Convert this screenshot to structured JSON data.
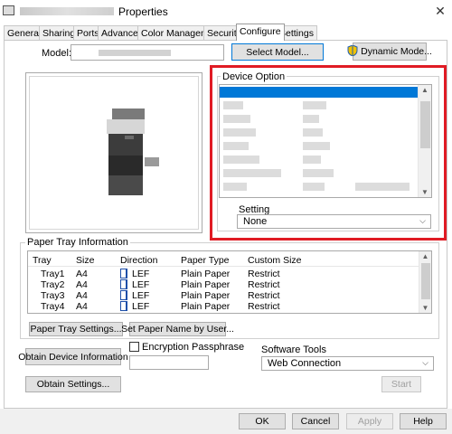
{
  "window": {
    "title": "Properties"
  },
  "tabs": [
    "General",
    "Sharing",
    "Ports",
    "Advanced",
    "Color Management",
    "Security",
    "Configure",
    "Settings"
  ],
  "active_tab": "Configure",
  "model": {
    "label": "Model:",
    "select_model_button": "Select Model...",
    "dynamic_mode_button": "Dynamic Mode..."
  },
  "device_option": {
    "title": "Device Option",
    "setting_label": "Setting",
    "setting_value": "None"
  },
  "paper_tray": {
    "title": "Paper Tray Information",
    "columns": [
      "Tray",
      "Size",
      "Direction",
      "Paper Type",
      "Custom Size"
    ],
    "rows": [
      {
        "tray": "Tray1",
        "size": "A4",
        "direction": "LEF",
        "paper_type": "Plain Paper",
        "custom_size": "Restrict"
      },
      {
        "tray": "Tray2",
        "size": "A4",
        "direction": "LEF",
        "paper_type": "Plain Paper",
        "custom_size": "Restrict"
      },
      {
        "tray": "Tray3",
        "size": "A4",
        "direction": "LEF",
        "paper_type": "Plain Paper",
        "custom_size": "Restrict"
      },
      {
        "tray": "Tray4",
        "size": "A4",
        "direction": "LEF",
        "paper_type": "Plain Paper",
        "custom_size": "Restrict"
      }
    ],
    "paper_tray_settings_button": "Paper Tray Settings...",
    "set_paper_name_button": "Set Paper Name by User..."
  },
  "obtain_device_info_button": "Obtain Device Information",
  "encryption_passphrase": {
    "label": "Encryption Passphrase",
    "checked": false
  },
  "obtain_settings_button": "Obtain Settings...",
  "software_tools": {
    "label": "Software Tools",
    "value": "Web Connection",
    "start_button": "Start"
  },
  "footer": {
    "ok": "OK",
    "cancel": "Cancel",
    "apply": "Apply",
    "help": "Help"
  },
  "colors": {
    "highlight": "#e01b24",
    "selection": "#0078d7"
  },
  "icons": [
    "printer-icon",
    "close-icon",
    "shield-icon",
    "lef-icon",
    "chevron-down-icon",
    "scroll-up-icon",
    "scroll-down-icon"
  ]
}
